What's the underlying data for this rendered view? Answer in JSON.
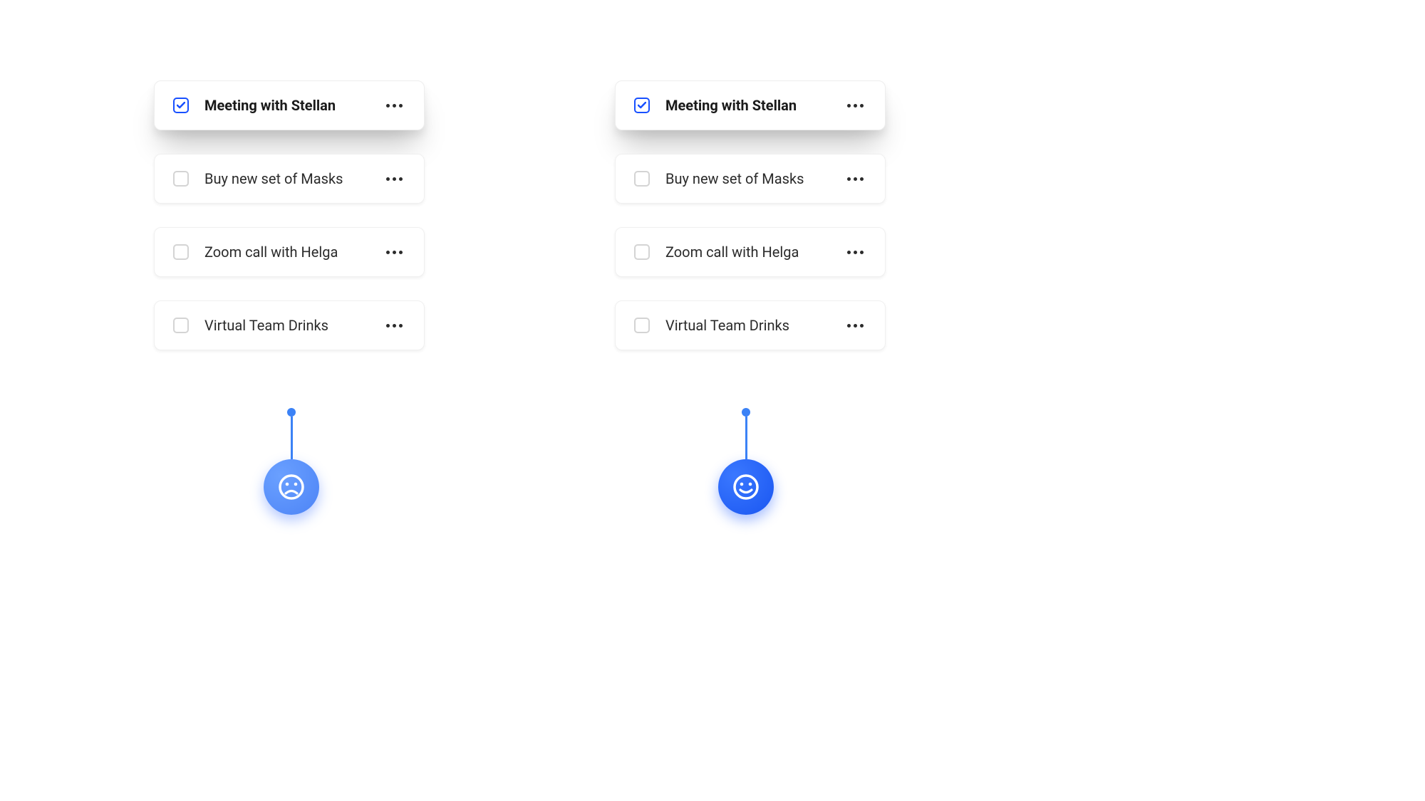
{
  "columns": {
    "left": {
      "indicator": "sad",
      "tasks": [
        {
          "label": "Meeting with Stellan",
          "checked": true,
          "elevated": true,
          "bold": true
        },
        {
          "label": "Buy new set of Masks",
          "checked": false,
          "elevated": false,
          "bold": false
        },
        {
          "label": "Zoom call with Helga",
          "checked": false,
          "elevated": false,
          "bold": false
        },
        {
          "label": "Virtual Team Drinks",
          "checked": false,
          "elevated": false,
          "bold": false
        }
      ]
    },
    "right": {
      "indicator": "happy",
      "tasks": [
        {
          "label": "Meeting with Stellan",
          "checked": true,
          "elevated": true,
          "bold": true
        },
        {
          "label": "Buy new set of Masks",
          "checked": false,
          "elevated": false,
          "bold": false
        },
        {
          "label": "Zoom call with Helga",
          "checked": false,
          "elevated": false,
          "bold": false
        },
        {
          "label": "Virtual Team Drinks",
          "checked": false,
          "elevated": false,
          "bold": false
        }
      ]
    }
  },
  "colors": {
    "checked_border": "#1850ff",
    "unchecked_border": "#d4d4d4",
    "text_bold": "#1a1a1a",
    "text_regular": "#2b2b2b"
  }
}
